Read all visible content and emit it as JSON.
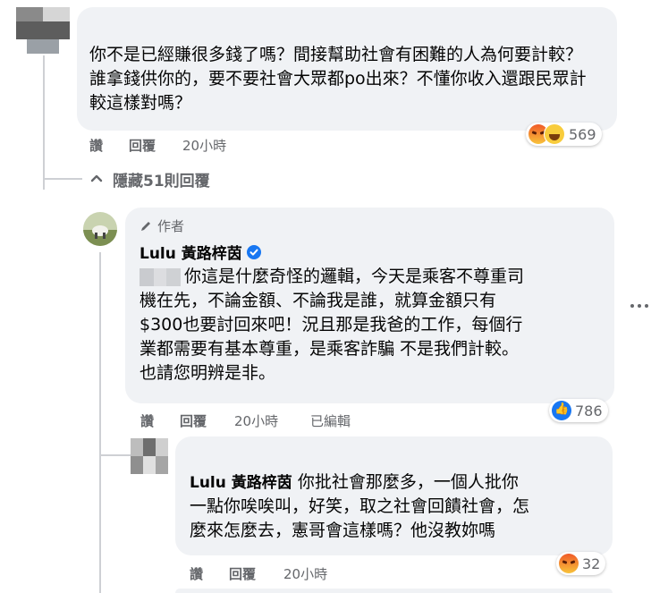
{
  "comment1": {
    "text": "你不是已經賺很多錢了嗎？間接幫助社會有困難的人為何要計較？誰拿錢供你的，要不要社會大眾都po出來？不懂你收入還跟民眾計較這樣對嗎？",
    "actions": {
      "like": "讚",
      "reply": "回覆",
      "time": "20小時"
    },
    "reactions": {
      "count": "569",
      "icons": [
        "angry-icon",
        "laugh-icon"
      ]
    }
  },
  "hide_replies": {
    "label": "隱藏51則回覆",
    "icon": "chevron-up-icon"
  },
  "reply1": {
    "author_badge": "作者",
    "author_name": "Lulu 黃路梓茵",
    "text_prefix": "你這是什麼奇怪的邏輯，今天是乘客不尊重司",
    "text_rest": "機在先，不論金額、不論我是誰，就算金額只有\n$300也要討回來吧！況且那是我爸的工作，每個行\n業都需要有基本尊重，是乘客詐騙 不是我們計較。\n也請您明辨是非。",
    "actions": {
      "like": "讚",
      "reply": "回覆",
      "time": "20小時",
      "edited": "已編輯"
    },
    "reactions": {
      "count": "786",
      "icons": [
        "like-icon"
      ]
    }
  },
  "reply2": {
    "mention": "Lulu 黃路梓茵",
    "text_first": " 你批社會那麼多，一個人批你",
    "text_rest": "一點你唉唉叫，好笑，取之社會回饋社會，怎\n麼來怎麼去，憲哥會這樣嗎？他沒教妳嗎",
    "actions": {
      "like": "讚",
      "reply": "回覆",
      "time": "20小時"
    },
    "reactions": {
      "count": "32",
      "icons": [
        "angry-icon"
      ]
    }
  },
  "colors": {
    "bubble": "#f0f2f5",
    "meta": "#65676b",
    "text": "#050505",
    "line": "#ced0d4",
    "verified": "#1877f2"
  }
}
